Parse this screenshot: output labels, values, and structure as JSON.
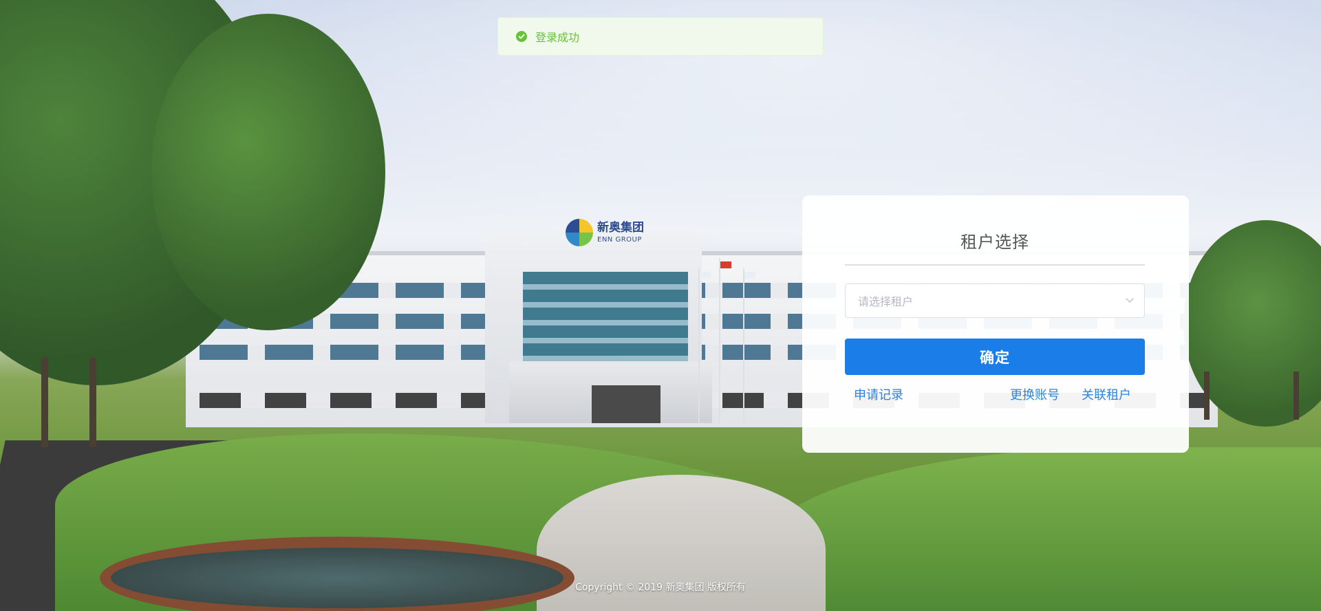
{
  "toast": {
    "message": "登录成功",
    "status_color": "#67c23a",
    "icon": "check-circle-icon"
  },
  "building_sign": {
    "cn": "新奥集团",
    "en": "ENN GROUP"
  },
  "tenant_panel": {
    "title": "租户选择",
    "select": {
      "placeholder": "请选择租户",
      "icon": "chevron-down-icon"
    },
    "confirm_label": "确定",
    "links": {
      "apply_records": "申请记录",
      "switch_account": "更换账号",
      "link_tenant": "关联租户"
    },
    "accent_color": "#1b7ee8"
  },
  "footer": {
    "copyright": "Copyright © 2019 新奥集团 版权所有"
  }
}
